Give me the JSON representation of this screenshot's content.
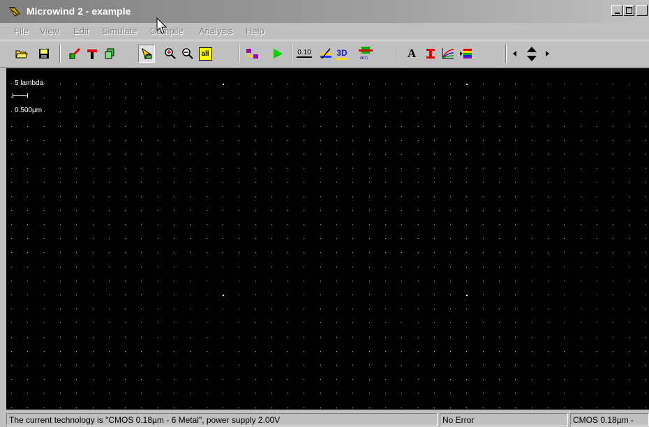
{
  "app": {
    "title": "Microwind 2 - example"
  },
  "menu": {
    "items": [
      "File",
      "View",
      "Edit",
      "Simulate",
      "Compile",
      "Analysis",
      "Help"
    ]
  },
  "toolbar": {
    "tools": [
      {
        "name": "open-file-icon"
      },
      {
        "name": "save-icon"
      },
      {
        "name": "draw-box-icon"
      },
      {
        "name": "add-mos-icon"
      },
      {
        "name": "copy-icon"
      },
      {
        "name": "select-icon",
        "pressed": true
      },
      {
        "name": "zoom-in-icon"
      },
      {
        "name": "zoom-out-icon"
      },
      {
        "name": "view-all-icon",
        "label": "all"
      },
      {
        "name": "connect-icon"
      },
      {
        "name": "run-simulation-icon"
      },
      {
        "name": "measure-distance-icon",
        "label": "0.10"
      },
      {
        "name": "cross-section-icon"
      },
      {
        "name": "3d-view-icon",
        "label": "3D"
      },
      {
        "name": "layout-arc-icon",
        "label": "arc"
      },
      {
        "name": "add-text-icon",
        "label": "A"
      },
      {
        "name": "design-rule-icon"
      },
      {
        "name": "characteristics-icon"
      },
      {
        "name": "palette-icon"
      },
      {
        "name": "move-left-icon"
      },
      {
        "name": "move-up-icon"
      },
      {
        "name": "move-down-icon"
      },
      {
        "name": "move-right-icon"
      }
    ]
  },
  "canvas": {
    "scale_lambda": "5 lambda",
    "scale_micron": "0.500µm"
  },
  "status": {
    "technology": "The current technology is  \"CMOS 0.18µm - 6 Metal\",  power supply  2.00V",
    "error": "No Error",
    "tech_short": "CMOS 0.18µm -"
  },
  "colors": {
    "canvas_bg": "#000000",
    "grid_dot": "#c8c890",
    "chrome": "#c0c0c0"
  }
}
